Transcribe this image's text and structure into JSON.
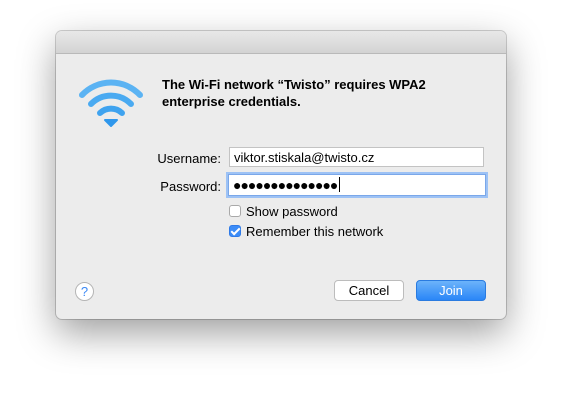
{
  "dialog": {
    "icon": "wifi-icon",
    "message": "The Wi-Fi network “Twisto” requires WPA2 enterprise credentials.",
    "username_label": "Username:",
    "username_value": "viktor.stiskala@twisto.cz",
    "password_label": "Password:",
    "password_value": "●●●●●●●●●●●●●●",
    "show_password_label": "Show password",
    "show_password_checked": false,
    "remember_label": "Remember this network",
    "remember_checked": true,
    "help_label": "?",
    "cancel_label": "Cancel",
    "join_label": "Join"
  },
  "colors": {
    "accent": "#3c8cf7",
    "wifi": "#3fa3ef",
    "dialog_bg": "#ececec"
  }
}
